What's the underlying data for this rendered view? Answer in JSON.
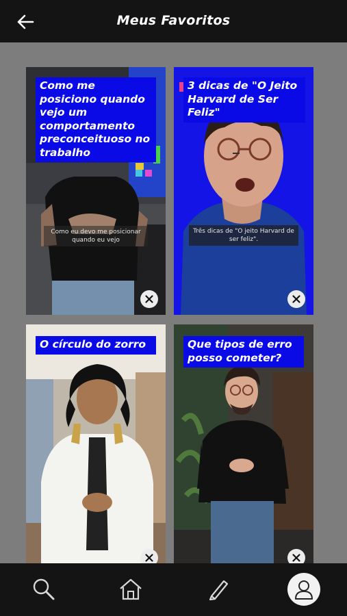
{
  "header": {
    "title": "Meus Favoritos",
    "back_icon": "arrow-left-icon"
  },
  "cards": [
    {
      "caption": "Como me posiciono quando vejo um comportamento preconceituoso no trabalho",
      "subtitle": "Como eu devo me posicionar quando eu vejo"
    },
    {
      "caption": "3 dicas de \"O Jeito Harvard de Ser Feliz\"",
      "subtitle": "Três dicas de \"O jeito Harvard de ser feliz\"."
    },
    {
      "caption": "O círculo do zorro"
    },
    {
      "caption": "Que tipos de erro posso cometer?"
    }
  ],
  "tabbar": {
    "items": [
      {
        "icon": "search-icon"
      },
      {
        "icon": "home-icon"
      },
      {
        "icon": "pencil-icon"
      },
      {
        "icon": "profile-icon",
        "active": true
      }
    ]
  },
  "colors": {
    "caption_bg": "#0a0ae6",
    "header_bg": "#141414",
    "page_bg": "#7d7d7d"
  }
}
